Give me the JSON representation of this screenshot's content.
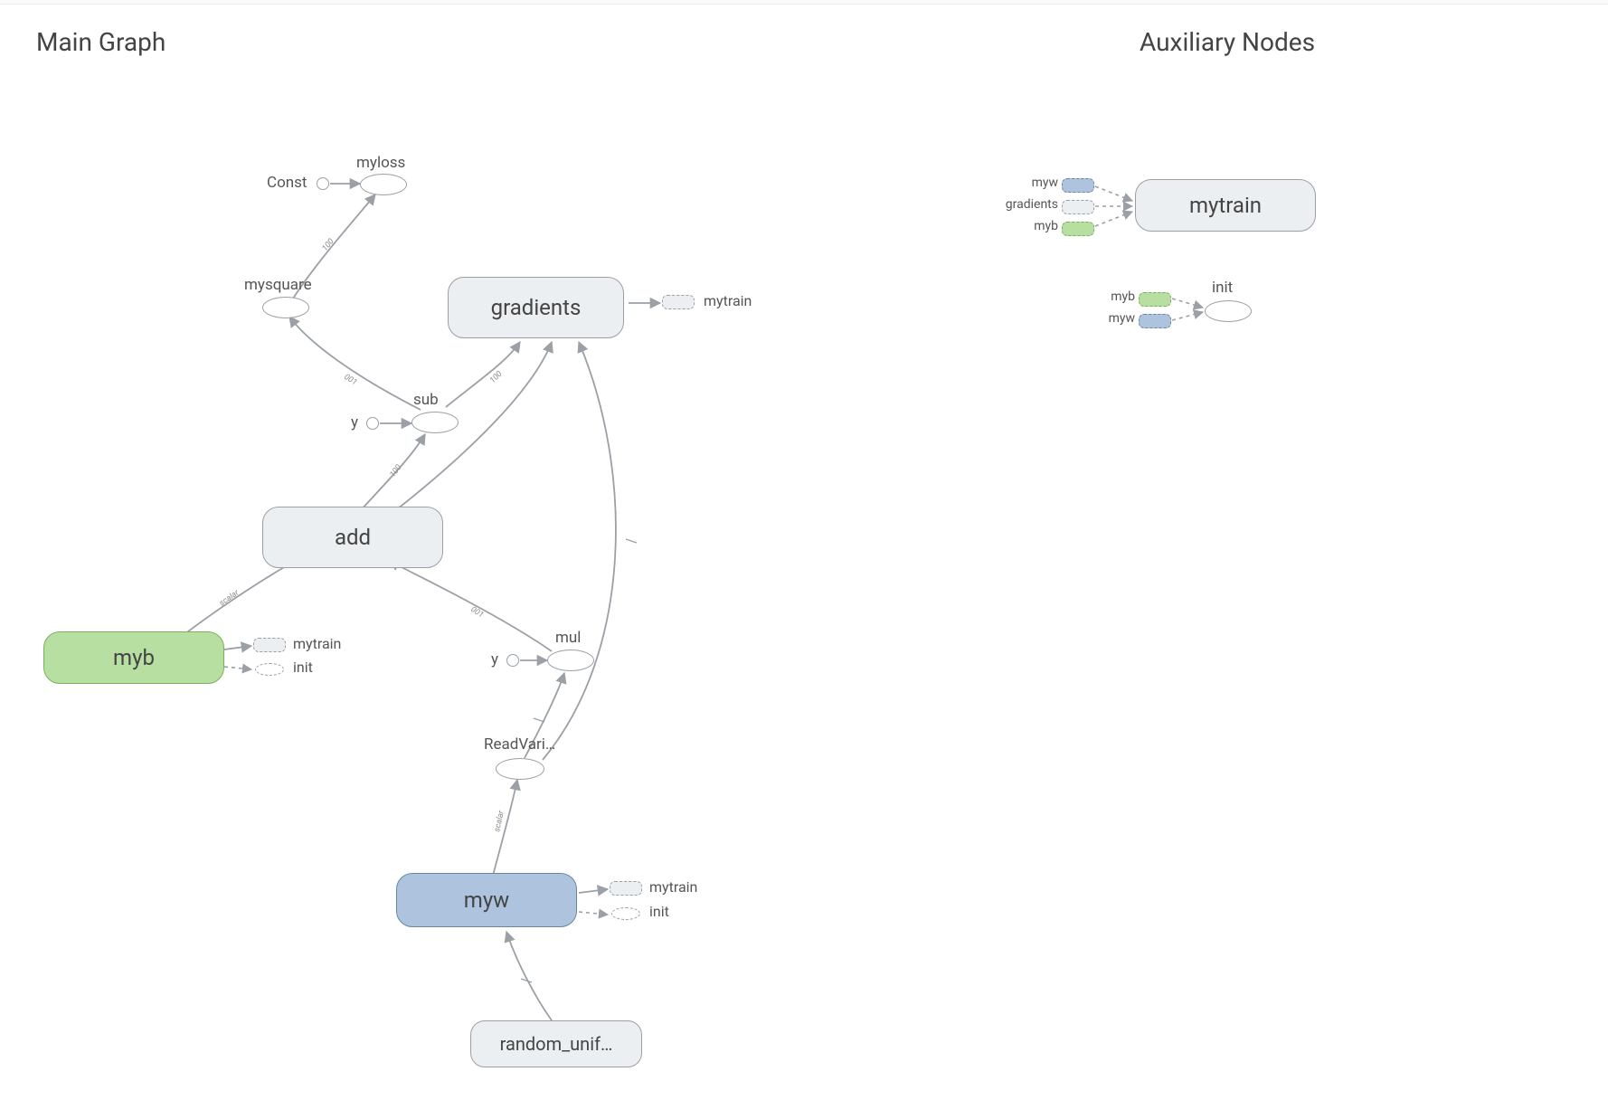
{
  "titles": {
    "main": "Main Graph",
    "aux": "Auxiliary Nodes"
  },
  "main_nodes": {
    "myloss": "myloss",
    "const": "Const",
    "mysquare": "mysquare",
    "gradients": "gradients",
    "mytrain_ref": "mytrain",
    "sub": "sub",
    "y1": "y",
    "add": "add",
    "myb": "myb",
    "mytrain_ref2": "mytrain",
    "init_ref": "init",
    "mul": "mul",
    "y2": "y",
    "readvar": "ReadVari…",
    "myw": "myw",
    "mytrain_ref3": "mytrain",
    "init_ref2": "init",
    "random_unif": "random_unif…"
  },
  "edge_labels": {
    "e_sq_to_loss": "100",
    "e_sub_to_sq": "001",
    "e_sub_to_grad": "100",
    "e_add_to_sub": "100",
    "e_mul_to_add": "001",
    "e_myb_scalar": "scalar",
    "e_rv_scalar": "scalar"
  },
  "aux": {
    "mytrain": "mytrain",
    "init": "init",
    "in_myw": "myw",
    "in_gradients": "gradients",
    "in_myb": "myb",
    "in_myb2": "myb",
    "in_myw2": "myw"
  }
}
